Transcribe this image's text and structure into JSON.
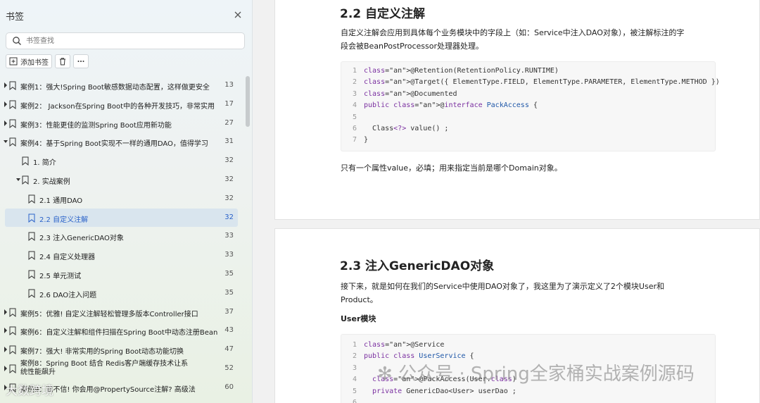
{
  "sidebar": {
    "title": "书签",
    "search_placeholder": "书签查找",
    "add_bookmark_label": "添加书签",
    "items": [
      {
        "title": "案例1：强大!Spring Boot敏感数据动态配置，这样做更安全",
        "page": "13",
        "level": 0,
        "expanded": false
      },
      {
        "title": "案例2：  Jackson在Spring Boot中的各种开发技巧，非常实用",
        "page": "17",
        "level": 0,
        "expanded": false
      },
      {
        "title": "案例3：性能更佳的监测Spring Boot应用新功能",
        "page": "27",
        "level": 0,
        "expanded": false
      },
      {
        "title": "案例4：基于Spring Boot实现不一样的通用DAO，值得学习",
        "page": "31",
        "level": 0,
        "expanded": true
      },
      {
        "title": "1. 简介",
        "page": "32",
        "level": 1,
        "expanded": null
      },
      {
        "title": "2. 实战案例",
        "page": "32",
        "level": 1,
        "expanded": true
      },
      {
        "title": "2.1 通用DAO",
        "page": "32",
        "level": 2,
        "expanded": null
      },
      {
        "title": "2.2 自定义注解",
        "page": "32",
        "level": 2,
        "expanded": null,
        "active": true
      },
      {
        "title": "2.3 注入GenericDAO对象",
        "page": "33",
        "level": 2,
        "expanded": null
      },
      {
        "title": "2.4 自定义处理器",
        "page": "33",
        "level": 2,
        "expanded": null
      },
      {
        "title": "2.5 单元测试",
        "page": "35",
        "level": 2,
        "expanded": null
      },
      {
        "title": "2.6 DAO注入问题",
        "page": "35",
        "level": 2,
        "expanded": null
      },
      {
        "title": "案例5：优雅! 自定义注解轻松管理多版本Controller接口",
        "page": "37",
        "level": 0,
        "expanded": false
      },
      {
        "title": "案例6：自定义注解和组件扫描在Spring Boot中动态注册Bean",
        "page": "43",
        "level": 0,
        "expanded": false
      },
      {
        "title": "案例7：强大! 非常实用的Spring Boot动态功能切换",
        "page": "47",
        "level": 0,
        "expanded": false
      },
      {
        "title": "案例8：Spring Boot 结合 Redis客户端缓存技术让系统性能飙升",
        "page": "52",
        "level": 0,
        "expanded": false,
        "two_line": true
      },
      {
        "title": "案例9：我不信! 你会用@PropertySource注解? 高级法",
        "page": "60",
        "level": 0,
        "expanded": false
      }
    ]
  },
  "doc": {
    "sec22": {
      "heading": "2.2 自定义注解",
      "para_line1": "自定义注解会应用到具体每个业务模块中的字段上（如：Service中注入DAO对象），被注解标注的字",
      "para_line2": "段会被BeanPostProcessor处理器处理。",
      "after": "只有一个属性value，必填；用来指定当前是哪个Domain对象。",
      "code": [
        "@Retention(RetentionPolicy.RUNTIME)",
        "@Target({ ElementType.FIELD, ElementType.PARAMETER, ElementType.METHOD })",
        "@Documented",
        "public @interface PackAccess {",
        "",
        "  Class<?> value() ;",
        "}"
      ]
    },
    "sec23": {
      "heading": "2.3 注入GenericDAO对象",
      "para_line1": "接下来，就是如何在我们的Service中使用DAO对象了，我这里为了演示定义了2个模块User和",
      "para_line2": "Product。",
      "subheading": "User模块",
      "code": [
        "@Service",
        "public class UserService {",
        "",
        "  @PackAccess(User.class)",
        "  private GenericDao<User> userDao ;",
        ""
      ]
    }
  },
  "watermark": "公众号 · Spring全家桶实战案例源码",
  "watermark2": "大数跨境",
  "colors": {
    "accent": "#2a62c9",
    "active_bg": "#d9e5ee"
  }
}
